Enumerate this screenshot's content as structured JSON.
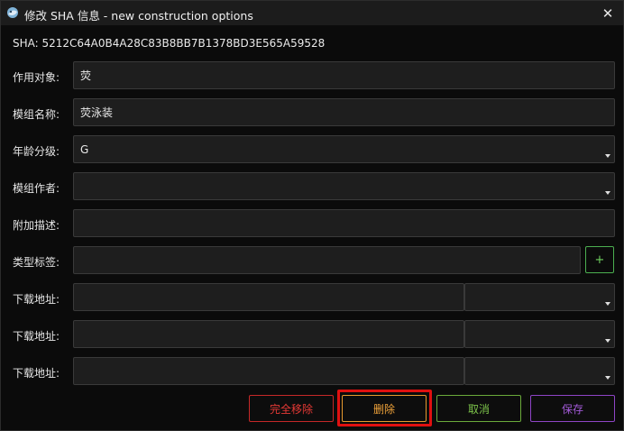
{
  "window": {
    "title": "修改 SHA 信息 - new construction options",
    "close_glyph": "✕"
  },
  "sha": "SHA: 5212C64A0B4A28C83B8BB7B1378BD3E565A59528",
  "fields": {
    "target": {
      "label": "作用对象:",
      "value": "荧"
    },
    "mod_name": {
      "label": "模组名称:",
      "value": "荧泳装"
    },
    "age_rating": {
      "label": "年龄分级:",
      "value": "G"
    },
    "mod_author": {
      "label": "模组作者:",
      "value": ""
    },
    "description": {
      "label": "附加描述:",
      "value": ""
    },
    "type_tags": {
      "label": "类型标签:",
      "value": "",
      "add_label": "+"
    },
    "downloads": [
      {
        "label": "下载地址:",
        "url": "",
        "source": ""
      },
      {
        "label": "下载地址:",
        "url": "",
        "source": ""
      },
      {
        "label": "下载地址:",
        "url": "",
        "source": ""
      }
    ]
  },
  "buttons": {
    "remove_all": "完全移除",
    "delete": "删除",
    "cancel": "取消",
    "save": "保存"
  },
  "colors": {
    "remove_all": "#e53935",
    "delete": "#f0a33a",
    "cancel": "#7cc34a",
    "save": "#a35ad8",
    "highlight": "#e01010"
  },
  "icons": {
    "app": "app-logo-icon",
    "close": "close-icon",
    "dropdown": "chevron-down-icon"
  }
}
